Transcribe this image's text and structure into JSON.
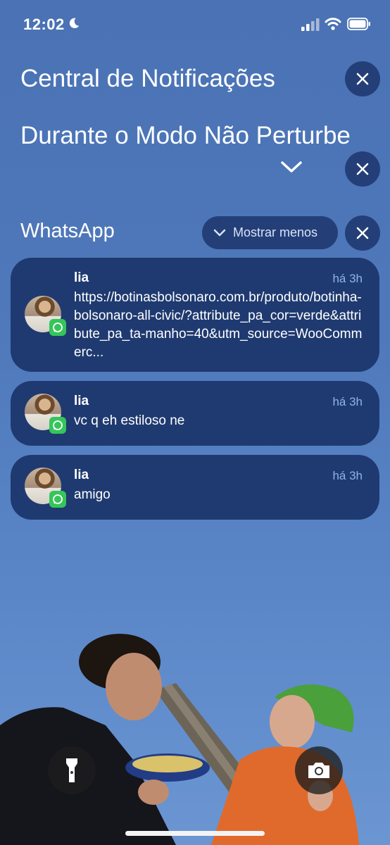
{
  "status_bar": {
    "time": "12:02"
  },
  "header": {
    "title": "Central de Notificações",
    "dnd_title": "Durante o Modo Não Perturbe"
  },
  "group": {
    "app_name": "WhatsApp",
    "show_less_label": "Mostrar menos"
  },
  "notifications": [
    {
      "sender": "lia",
      "time": "há 3h",
      "message": "https://botinasbolsonaro.com.br/produto/botinha-bolsonaro-all-civic/?attribute_pa_cor=verde&attribute_pa_ta-manho=40&utm_source=WooCommerc..."
    },
    {
      "sender": "lia",
      "time": "há 3h",
      "message": "vc q eh estiloso ne"
    },
    {
      "sender": "lia",
      "time": "há 3h",
      "message": "amigo"
    }
  ],
  "icons": [
    "moon-icon",
    "signal-icon",
    "wifi-icon",
    "battery-icon",
    "close-icon",
    "chevron-down-icon",
    "whatsapp-icon",
    "flashlight-icon",
    "camera-icon"
  ],
  "colors": {
    "card_bg": "#1f3a70",
    "button_bg": "#243f78",
    "whatsapp_green": "#35c55a",
    "timestamp": "#8fb2ea"
  }
}
